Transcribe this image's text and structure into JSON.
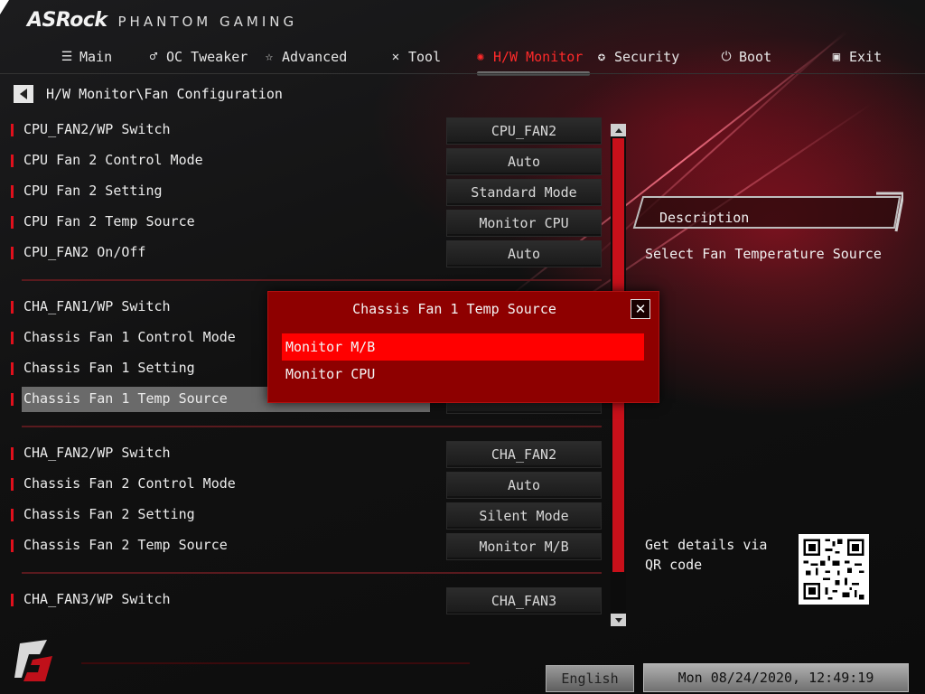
{
  "brand": {
    "name": "ASRock",
    "tagline": "PHANTOM GAMING"
  },
  "nav": {
    "items": [
      {
        "label": "Main",
        "icon": "list-icon",
        "active": false
      },
      {
        "label": "OC Tweaker",
        "icon": "rocket-icon",
        "active": false
      },
      {
        "label": "Advanced",
        "icon": "star-icon",
        "active": false
      },
      {
        "label": "Tool",
        "icon": "tools-icon",
        "active": false
      },
      {
        "label": "H/W Monitor",
        "icon": "monitor-gauge-icon",
        "active": true
      },
      {
        "label": "Security",
        "icon": "shield-icon",
        "active": false
      },
      {
        "label": "Boot",
        "icon": "power-icon",
        "active": false
      },
      {
        "label": "Exit",
        "icon": "exit-door-icon",
        "active": false
      }
    ]
  },
  "breadcrumb": "H/W Monitor\\Fan Configuration",
  "settings": [
    {
      "label": "CPU_FAN2/WP Switch",
      "value": "CPU_FAN2"
    },
    {
      "label": "CPU Fan 2 Control Mode",
      "value": "Auto"
    },
    {
      "label": "CPU Fan 2 Setting",
      "value": "Standard Mode"
    },
    {
      "label": "CPU Fan 2 Temp Source",
      "value": "Monitor CPU"
    },
    {
      "label": "CPU_FAN2 On/Off",
      "value": "Auto"
    },
    {
      "label": "CHA_FAN1/WP Switch",
      "value": ""
    },
    {
      "label": "Chassis Fan 1 Control Mode",
      "value": ""
    },
    {
      "label": "Chassis Fan 1 Setting",
      "value": ""
    },
    {
      "label": "Chassis Fan 1 Temp Source",
      "value": ""
    },
    {
      "label": "CHA_FAN2/WP Switch",
      "value": "CHA_FAN2"
    },
    {
      "label": "Chassis Fan 2 Control Mode",
      "value": "Auto"
    },
    {
      "label": "Chassis Fan 2 Setting",
      "value": "Silent Mode"
    },
    {
      "label": "Chassis Fan 2 Temp Source",
      "value": "Monitor M/B"
    },
    {
      "label": "CHA_FAN3/WP Switch",
      "value": "CHA_FAN3"
    }
  ],
  "description": {
    "title": "Description",
    "text": "Select Fan Temperature Source"
  },
  "qr": {
    "text": "Get details via QR code"
  },
  "popup": {
    "title": "Chassis Fan 1 Temp Source",
    "close_icon": "close-icon",
    "options": [
      "Monitor M/B",
      "Monitor CPU"
    ],
    "selected": "Monitor M/B"
  },
  "footer": {
    "language": "English",
    "datetime": "Mon 08/24/2020, 12:49:19"
  },
  "colors": {
    "accent": "#ff0000",
    "popup_bg": "#8e0000",
    "highlight_row": "#6a6a6a"
  }
}
